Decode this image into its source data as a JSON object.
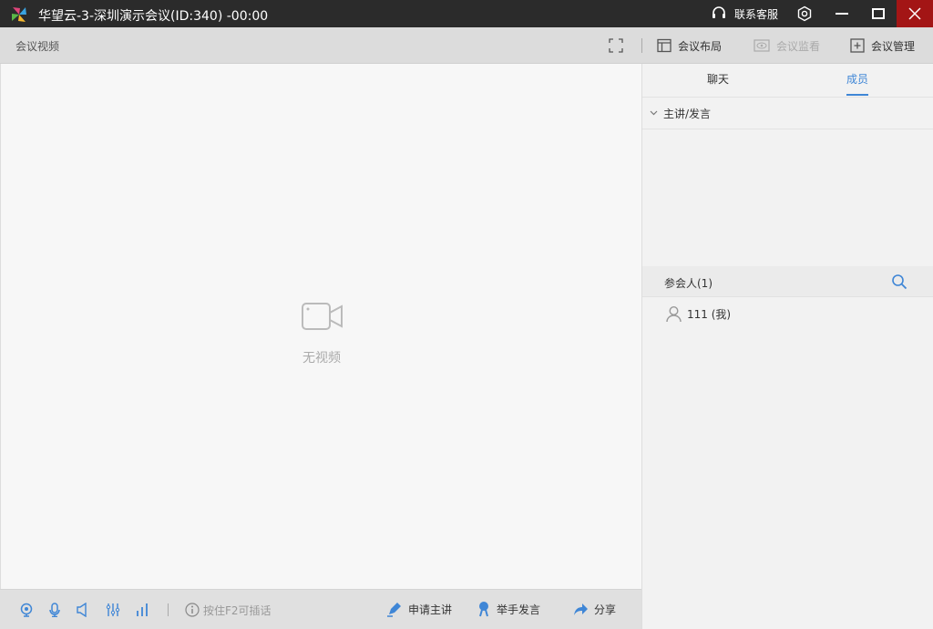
{
  "titlebar": {
    "title": "华望云-3-深圳演示会议(ID:340) -00:00",
    "support": "联系客服"
  },
  "toolbar": {
    "section": "会议视频",
    "layout": "会议布局",
    "monitor": "会议监看",
    "manage": "会议管理"
  },
  "video": {
    "empty_text": "无视频"
  },
  "bottombar": {
    "hint": "按住F2可插话",
    "apply_speaker": "申请主讲",
    "raise_hand": "举手发言",
    "share": "分享"
  },
  "panel": {
    "tabs": [
      {
        "label": "聊天"
      },
      {
        "label": "成员"
      }
    ],
    "active_tab": "成员",
    "speaker_section": "主讲/发言",
    "participants_header": "参会人(1)",
    "participants": [
      {
        "name": "111 (我)"
      }
    ]
  },
  "colors": {
    "accent": "#3f86d6",
    "close": "#a31515"
  }
}
